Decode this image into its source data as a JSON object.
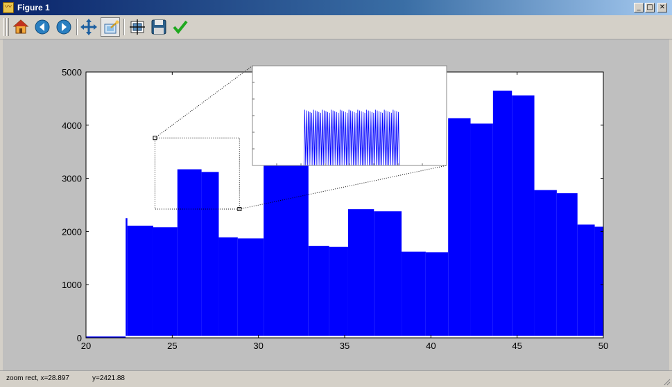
{
  "window": {
    "title": "Figure 1",
    "icon": "matplotlib-app-icon"
  },
  "toolbar": {
    "buttons": [
      {
        "name": "home-button",
        "icon": "home-icon"
      },
      {
        "name": "back-button",
        "icon": "back-arrow-icon"
      },
      {
        "name": "forward-button",
        "icon": "forward-arrow-icon"
      },
      {
        "name": "pan-button",
        "icon": "pan-icon"
      },
      {
        "name": "zoom-button",
        "icon": "zoom-rect-icon",
        "active": true
      },
      {
        "name": "configure-subplots-button",
        "icon": "subplots-icon"
      },
      {
        "name": "save-button",
        "icon": "save-icon"
      },
      {
        "name": "edit-parameters-button",
        "icon": "checkmark-icon"
      }
    ]
  },
  "status": {
    "x_text": "zoom rect, x=28.897",
    "y_text": "y=2421.88"
  },
  "colors": {
    "series": "#0000ff",
    "canvas_bg": "#bfbfbf",
    "axes_bg": "#ffffff"
  },
  "chart_data": {
    "type": "area",
    "xlim": [
      20,
      50
    ],
    "ylim": [
      0,
      5000
    ],
    "xticks": [
      20,
      25,
      30,
      35,
      40,
      45,
      50
    ],
    "yticks": [
      0,
      1000,
      2000,
      3000,
      4000,
      5000
    ],
    "grid": false,
    "series": [
      {
        "steps": [
          {
            "x0": 20.0,
            "x1": 22.3,
            "top": 0,
            "bottom": 0
          },
          {
            "x0": 22.3,
            "x1": 22.4,
            "top": 2250,
            "bottom": 40
          },
          {
            "x0": 22.4,
            "x1": 23.9,
            "top": 2110,
            "bottom": 40
          },
          {
            "x0": 23.9,
            "x1": 25.3,
            "top": 2080,
            "bottom": 40
          },
          {
            "x0": 25.3,
            "x1": 26.7,
            "top": 3170,
            "bottom": 40
          },
          {
            "x0": 26.7,
            "x1": 27.7,
            "top": 3120,
            "bottom": 40
          },
          {
            "x0": 27.7,
            "x1": 28.8,
            "top": 1890,
            "bottom": 40
          },
          {
            "x0": 28.8,
            "x1": 30.3,
            "top": 1870,
            "bottom": 40
          },
          {
            "x0": 30.3,
            "x1": 32.9,
            "top": 4000,
            "bottom": 40
          },
          {
            "x0": 32.9,
            "x1": 34.1,
            "top": 1730,
            "bottom": 40
          },
          {
            "x0": 34.1,
            "x1": 35.2,
            "top": 1710,
            "bottom": 40
          },
          {
            "x0": 35.2,
            "x1": 36.7,
            "top": 2420,
            "bottom": 40
          },
          {
            "x0": 36.7,
            "x1": 38.3,
            "top": 2380,
            "bottom": 40
          },
          {
            "x0": 38.3,
            "x1": 39.7,
            "top": 1620,
            "bottom": 40
          },
          {
            "x0": 39.7,
            "x1": 41.0,
            "top": 1610,
            "bottom": 40
          },
          {
            "x0": 41.0,
            "x1": 42.3,
            "top": 4130,
            "bottom": 40
          },
          {
            "x0": 42.3,
            "x1": 43.6,
            "top": 4030,
            "bottom": 40
          },
          {
            "x0": 43.6,
            "x1": 44.7,
            "top": 4650,
            "bottom": 40
          },
          {
            "x0": 44.7,
            "x1": 46.0,
            "top": 4560,
            "bottom": 40
          },
          {
            "x0": 46.0,
            "x1": 47.3,
            "top": 2780,
            "bottom": 40
          },
          {
            "x0": 47.3,
            "x1": 48.5,
            "top": 2720,
            "bottom": 40
          },
          {
            "x0": 48.5,
            "x1": 49.5,
            "top": 2130,
            "bottom": 40
          },
          {
            "x0": 49.5,
            "x1": 50.0,
            "top": 2090,
            "bottom": 40
          }
        ]
      }
    ],
    "zoom_region": {
      "x0": 24.0,
      "x1": 28.9,
      "y0": 2421.88,
      "y1": 3760
    },
    "inset": {
      "type": "line",
      "xlim": [
        24.0,
        28.9
      ],
      "ylim": [
        2421.88,
        3760
      ],
      "ticks_labeled": false,
      "burst": {
        "x0": 25.3,
        "x1": 27.7,
        "top": 3170
      }
    }
  }
}
